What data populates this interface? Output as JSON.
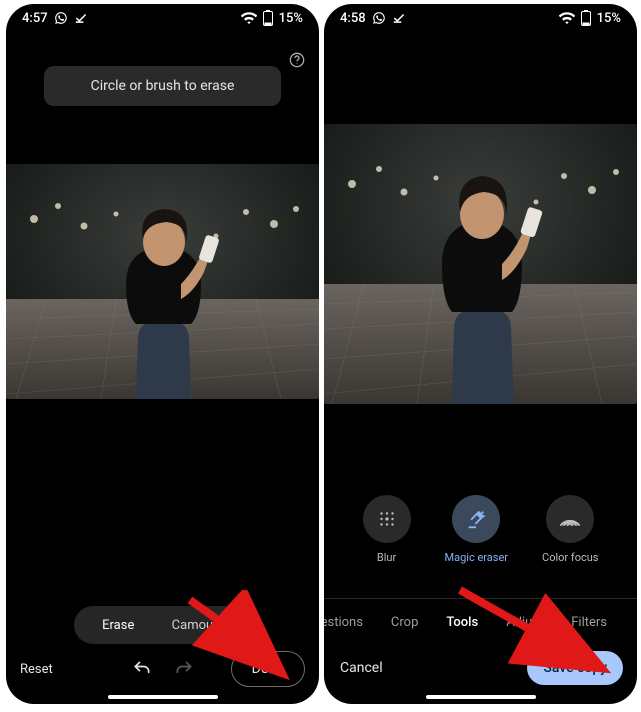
{
  "left": {
    "status": {
      "time": "4:57",
      "battery": "15%"
    },
    "instruction": "Circle or brush to erase",
    "modes": {
      "erase": "Erase",
      "camouflage": "Camouflage"
    },
    "reset": "Reset",
    "done": "Done"
  },
  "right": {
    "status": {
      "time": "4:58",
      "battery": "15%"
    },
    "tools": {
      "blur": "Blur",
      "magic_eraser": "Magic eraser",
      "color_focus": "Color focus"
    },
    "tabs": {
      "suggestions": "ggestions",
      "crop": "Crop",
      "tools": "Tools",
      "adjust": "Adjust",
      "filters": "Filters"
    },
    "cancel": "Cancel",
    "save_copy": "Save copy"
  }
}
